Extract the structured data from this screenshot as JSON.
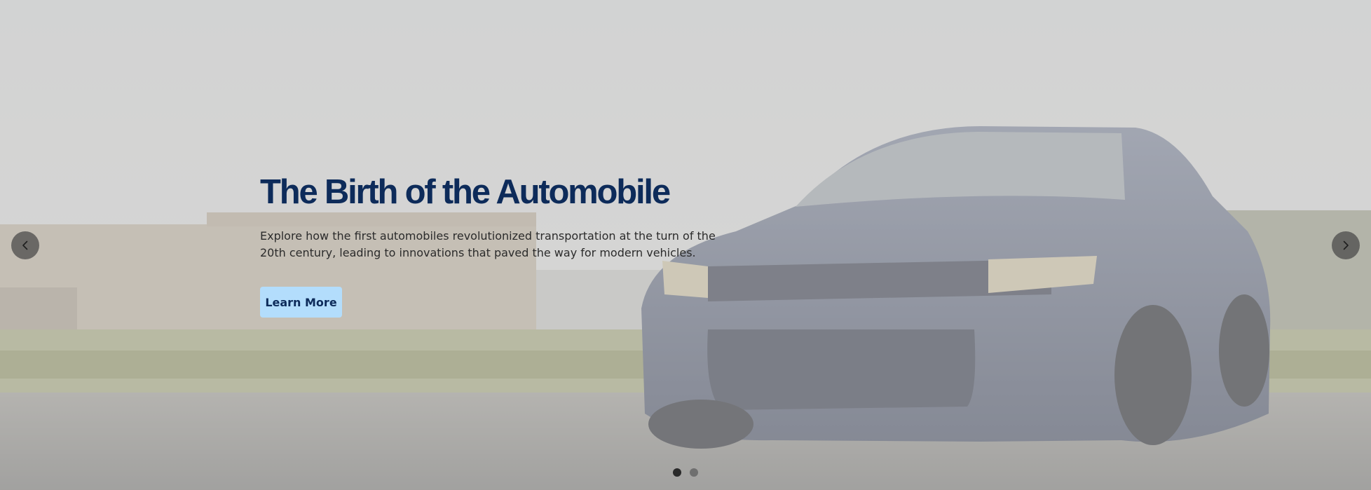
{
  "hero": {
    "title": "The Birth of the Automobile",
    "description": "Explore how the first automobiles revolutionized transportation at the turn of the 20th century, leading to innovations that paved the way for modern vehicles.",
    "cta_label": "Learn More",
    "background_image": "dark-blue-sports-car-in-parking-lot"
  },
  "carousel": {
    "prev_icon": "chevron-left-icon",
    "next_icon": "chevron-right-icon",
    "slide_count": 2,
    "active_slide": 1
  },
  "colors": {
    "title": "#0d2b5a",
    "button_bg": "#b3ddfc",
    "overlay": "#d7d7d7"
  }
}
